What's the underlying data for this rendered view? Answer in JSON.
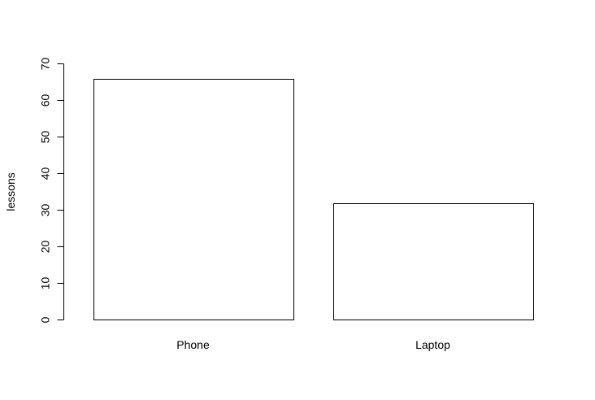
{
  "chart_data": {
    "type": "bar",
    "categories": [
      "Phone",
      "Laptop"
    ],
    "values": [
      66,
      32
    ],
    "title": "",
    "xlabel": "",
    "ylabel": "lessons",
    "ylim": [
      0,
      70
    ],
    "yticks": [
      0,
      10,
      20,
      30,
      40,
      50,
      60,
      70
    ],
    "grid": false,
    "legend": "none",
    "colors": {
      "bar_fill": "#ffffff",
      "bar_stroke": "#000000",
      "axis": "#000000"
    }
  }
}
